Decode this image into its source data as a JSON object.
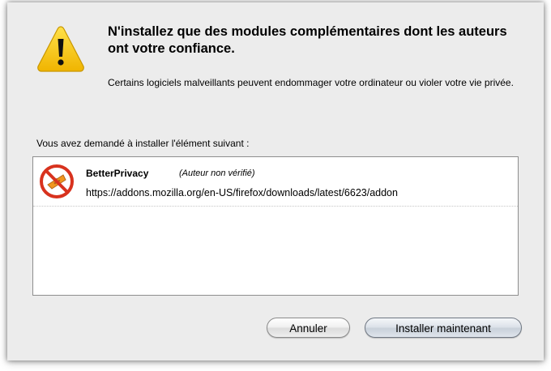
{
  "dialog": {
    "heading": "N'installez que des modules complémentaires dont les auteurs ont votre confiance.",
    "message": "Certains logiciels malveillants peuvent endommager votre ordinateur ou violer votre vie privée.",
    "list_label": "Vous avez demandé à installer l'élément suivant :",
    "items": [
      {
        "name": "BetterPrivacy",
        "author_note": "(Auteur non vérifié)",
        "url": "https://addons.mozilla.org/en-US/firefox/downloads/latest/6623/addon",
        "icon": "betterprivacy-icon"
      }
    ],
    "buttons": {
      "cancel": "Annuler",
      "install": "Installer maintenant"
    },
    "icons": {
      "warning": "warning-icon"
    },
    "colors": {
      "warning_yellow": "#f5c400",
      "addon_red": "#d8321e",
      "addon_orange": "#f0961e",
      "dialog_bg": "#ececec"
    }
  }
}
